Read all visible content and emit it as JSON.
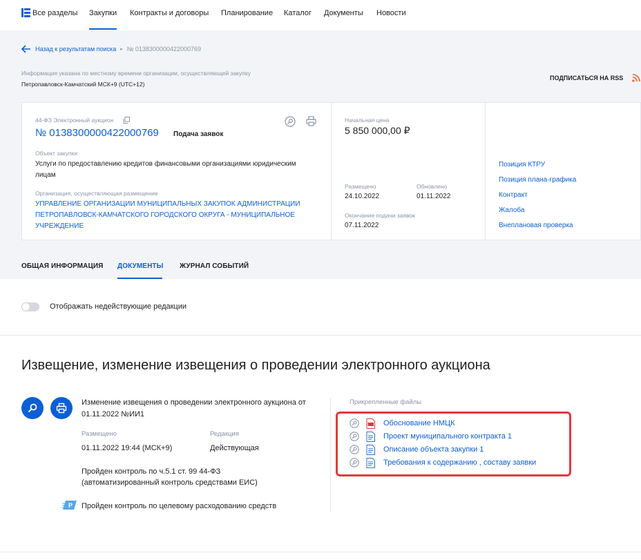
{
  "nav": {
    "items": [
      "Все разделы",
      "Закупки",
      "Контракты и договоры",
      "Планирование",
      "Каталог",
      "Документы",
      "Новости"
    ]
  },
  "breadcrumb": {
    "back": "Назад к результатам поиска",
    "current": "№ 0138300000422000769"
  },
  "org_info": {
    "note": "Информация указана по местному времени организации, осуществляющей закупку",
    "timezone": "Петропавловск-Камчатский МСК+9 (UTC+12)"
  },
  "rss": "ПОДПИСАТЬСЯ НА RSS",
  "card": {
    "law": "44-ФЗ Электронный аукцион",
    "number": "№ 0138300000422000769",
    "stage": "Подача заявок",
    "object_label": "Объект закупки",
    "object_line1": "Услуги по предоставлению кредитов финансовыми организациями юридическим",
    "object_line2": "лицам",
    "org_label": "Организация, осуществляющая размещение",
    "org_line1": "УПРАВЛЕНИЕ ОРГАНИЗАЦИИ МУНИЦИПАЛЬНЫХ ЗАКУПОК АДМИНИСТРАЦИИ",
    "org_line2": "ПЕТРОПАВЛОВСК-КАМЧАТСКОГО ГОРОДСКОГО ОКРУГА - МУНИЦИПАЛЬНОЕ",
    "org_line3": "УЧРЕЖДЕНИЕ",
    "price_label": "Начальная цена",
    "price": "5 850 000,00 ₽",
    "placed_label": "Размещено",
    "placed": "24.10.2022",
    "updated_label": "Обновлено",
    "updated": "01.11.2022",
    "deadline_label": "Окончание подачи заявок",
    "deadline": "07.11.2022",
    "links": [
      "Позиция КТРУ",
      "Позиция плана-графика",
      "Контракт",
      "Жалоба",
      "Внеплановая проверка"
    ]
  },
  "tabs": [
    "ОБЩАЯ ИНФОРМАЦИЯ",
    "ДОКУМЕНТЫ",
    "ЖУРНАЛ СОБЫТИЙ"
  ],
  "toggle_label": "Отображать недействующие редакции",
  "section_title": "Извещение, изменение извещения о проведении электронного аукциона",
  "doc": {
    "title_line1": "Изменение извещения о проведении электронного аукциона от",
    "title_line2": "01.11.2022 №ИИ1",
    "placed_label": "Размещено",
    "placed": "01.11.2022 19:44 (МСК+9)",
    "edition_label": "Редакция",
    "edition": "Действующая",
    "control_line1": "Пройден контроль по ч.5.1 ст. 99 44-ФЗ",
    "control_line2": "(автоматизированный контроль средствами ЕИС)",
    "target_control": "Пройден контроль по целевому расходованию средств"
  },
  "files": {
    "label": "Прикрепленные файлы",
    "items": [
      {
        "name": "Обоснование НМЦК",
        "type": "pdf"
      },
      {
        "name": "Проект муниципального контракта 1",
        "type": "doc"
      },
      {
        "name": "Описание объекта закупки 1",
        "type": "doc"
      },
      {
        "name": "Требования к содержанию , составу заявки",
        "type": "doc"
      }
    ]
  },
  "colors": {
    "accent": "#0d5fd6",
    "highlight": "#e0393e",
    "pdf": "#e0393e"
  }
}
